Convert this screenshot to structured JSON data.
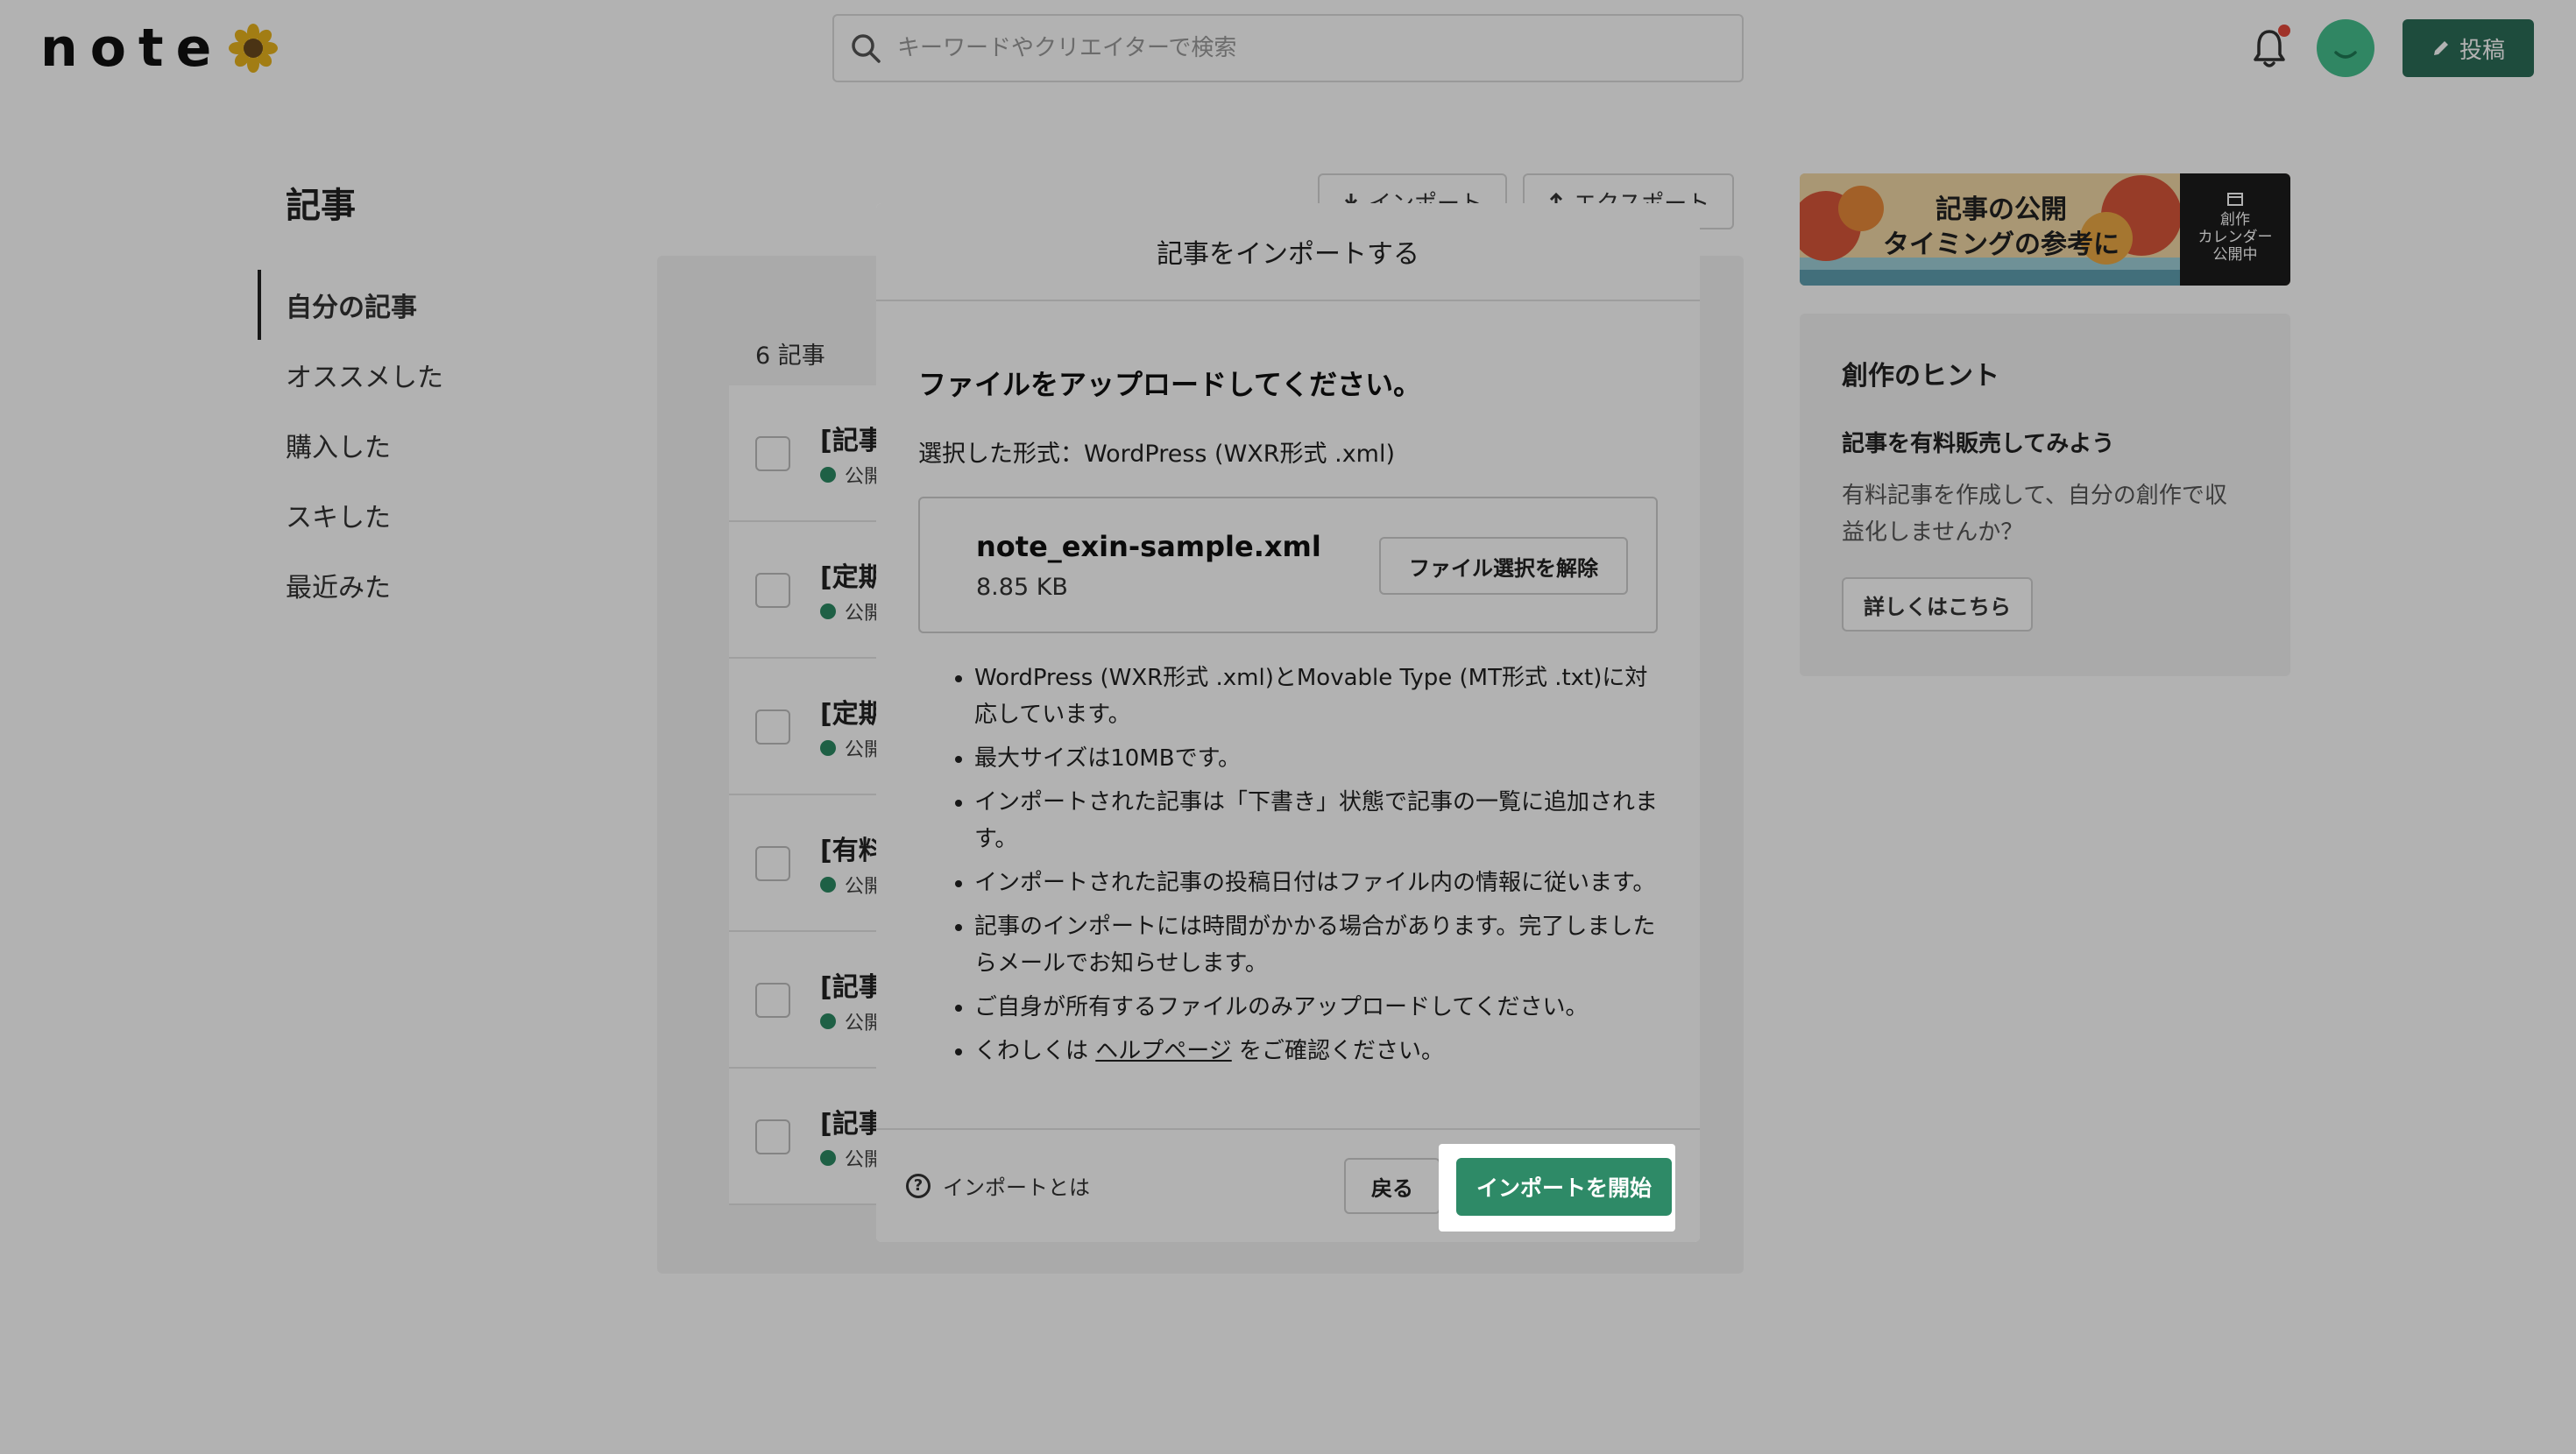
{
  "header": {
    "logo_text": "note",
    "search_placeholder": "キーワードやクリエイターで検索",
    "post_label": "投稿"
  },
  "sidebar": {
    "title": "記事",
    "items": [
      {
        "label": "自分の記事",
        "active": true
      },
      {
        "label": "オススメした",
        "active": false
      },
      {
        "label": "購入した",
        "active": false
      },
      {
        "label": "スキした",
        "active": false
      },
      {
        "label": "最近みた",
        "active": false
      }
    ]
  },
  "main": {
    "import_label": "インポート",
    "export_label": "エクスポート",
    "count_label": "6 記事",
    "rows": [
      {
        "title": "[記事",
        "status": "公開"
      },
      {
        "title": "[定期",
        "status": "公開"
      },
      {
        "title": "[定期",
        "status": "公開"
      },
      {
        "title": "[有料",
        "status": "公開"
      },
      {
        "title": "[記事",
        "status": "公開"
      },
      {
        "title": "[記事",
        "status": "公開"
      }
    ]
  },
  "banner": {
    "line1": "記事の公開",
    "line2": "タイミングの参考に",
    "side_line1": "創作",
    "side_line2": "カレンダー",
    "side_line3": "公開中"
  },
  "hint": {
    "title": "創作のヒント",
    "subtitle": "記事を有料販売してみよう",
    "description": "有料記事を作成して、自分の創作で収益化しませんか？",
    "button": "詳しくはこちら"
  },
  "modal": {
    "title": "記事をインポートする",
    "upload_heading": "ファイルをアップロードしてください。",
    "format_line": "選択した形式：WordPress (WXR形式 .xml)",
    "file_name": "note_exin-sample.xml",
    "file_size": "8.85 KB",
    "clear_button": "ファイル選択を解除",
    "notes": [
      "WordPress (WXR形式 .xml)とMovable Type (MT形式 .txt)に対応しています。",
      "最大サイズは10MBです。",
      "インポートされた記事は「下書き」状態で記事の一覧に追加されます。",
      "インポートされた記事の投稿日付はファイル内の情報に従います。",
      "記事のインポートには時間がかかる場合があります。完了しましたらメールでお知らせします。",
      "ご自身が所有するファイルのみアップロードしてください。"
    ],
    "help_prefix": "くわしくは",
    "help_link": "ヘルプページ",
    "help_suffix": "をご確認ください。",
    "what_import": "インポートとは",
    "back_button": "戻る",
    "start_button": "インポートを開始"
  },
  "colors": {
    "accent": "#2e8a67",
    "brand_dark": "#2c6d58",
    "notification": "#e5483b"
  }
}
